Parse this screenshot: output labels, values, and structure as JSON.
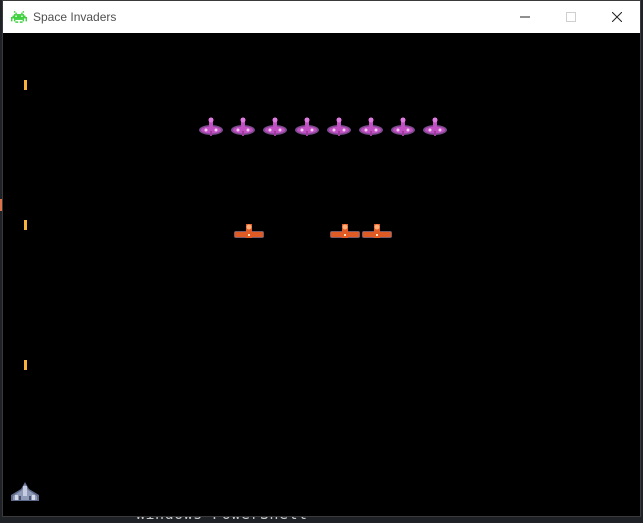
{
  "window": {
    "title": "Space Invaders",
    "icon": "space-invader-icon",
    "controls": [
      "minimize-icon",
      "maximize-icon",
      "close-icon"
    ]
  },
  "background_app": {
    "visible_text": "Windows PowerShell"
  },
  "game": {
    "background_color": "#000000",
    "purple_invaders_count": 8,
    "orange_invaders_count": 3,
    "player_lives_shown": 1,
    "bullets_count": 3,
    "colors": {
      "purple_invader": "#c24fc3",
      "orange_invader": "#e05a24",
      "bullet": "#f6b23a",
      "player": "#8f9ab8"
    }
  }
}
